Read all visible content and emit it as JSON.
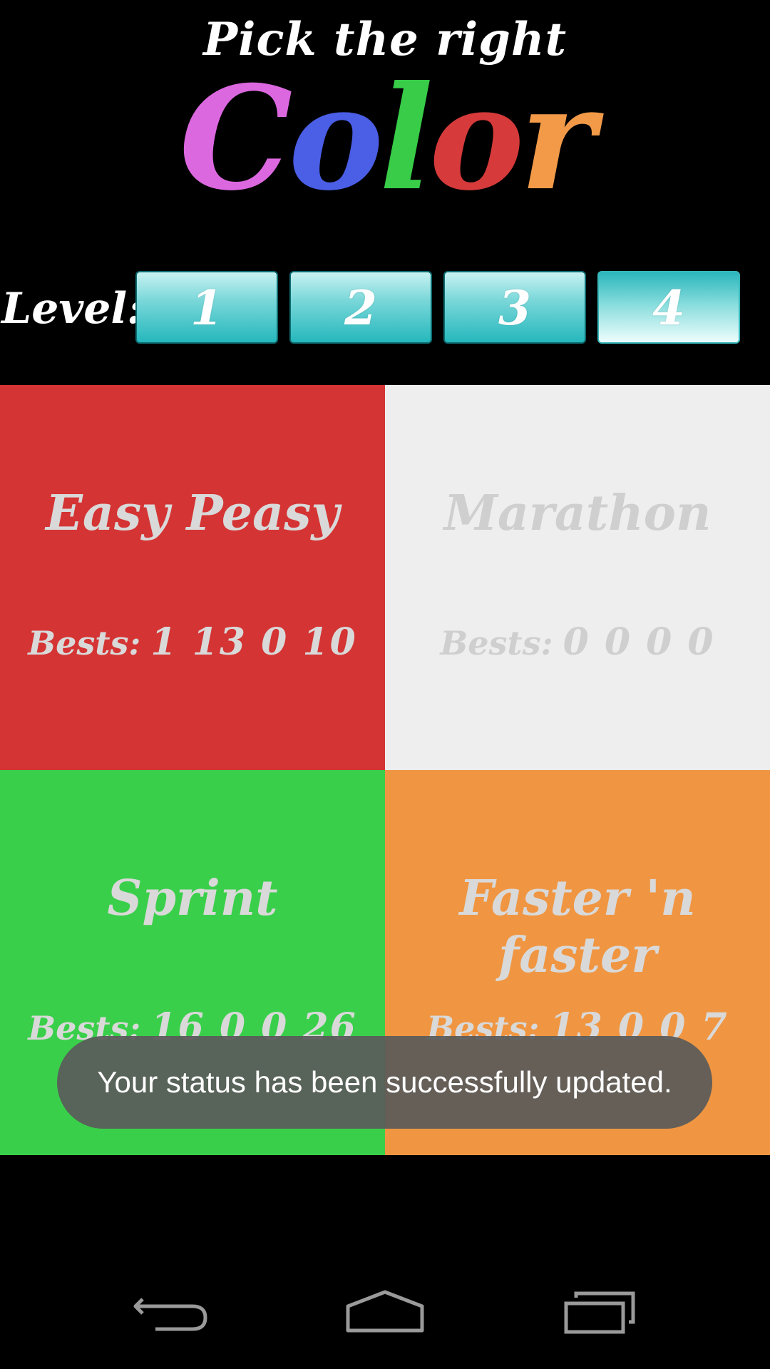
{
  "header": {
    "subtitle": "Pick the right",
    "logo_letters": [
      {
        "char": "C",
        "color": "#dc68e0"
      },
      {
        "char": "o",
        "color": "#4a5ee6"
      },
      {
        "char": "l",
        "color": "#38cc48"
      },
      {
        "char": "o",
        "color": "#d63a3a"
      },
      {
        "char": "r",
        "color": "#f29a48"
      }
    ]
  },
  "level": {
    "label": "Level:",
    "options": [
      "1",
      "2",
      "3",
      "4"
    ],
    "selected": "4"
  },
  "modes": [
    {
      "title": "Easy Peasy",
      "bests_label": "Bests:",
      "bests_values": "1 13 0 10",
      "bg": "#d43433",
      "text_color": "#d9d9d9"
    },
    {
      "title": "Marathon",
      "bests_label": "Bests:",
      "bests_values": "0 0 0 0",
      "bg": "#eeeeee",
      "text_color": "#cfcfcf"
    },
    {
      "title": "Sprint",
      "bests_label": "Bests:",
      "bests_values": "16 0 0 26",
      "bg": "#3acf4a",
      "text_color": "#d9d9d9"
    },
    {
      "title": "Faster 'n faster",
      "bests_label": "Bests:",
      "bests_values": "13 0 0 7",
      "bg": "#f09642",
      "text_color": "#d9d9d9"
    }
  ],
  "toast": {
    "message": "Your status has been successfully updated."
  },
  "navbar": {
    "icons": [
      "back-icon",
      "home-icon",
      "recent-apps-icon"
    ]
  }
}
